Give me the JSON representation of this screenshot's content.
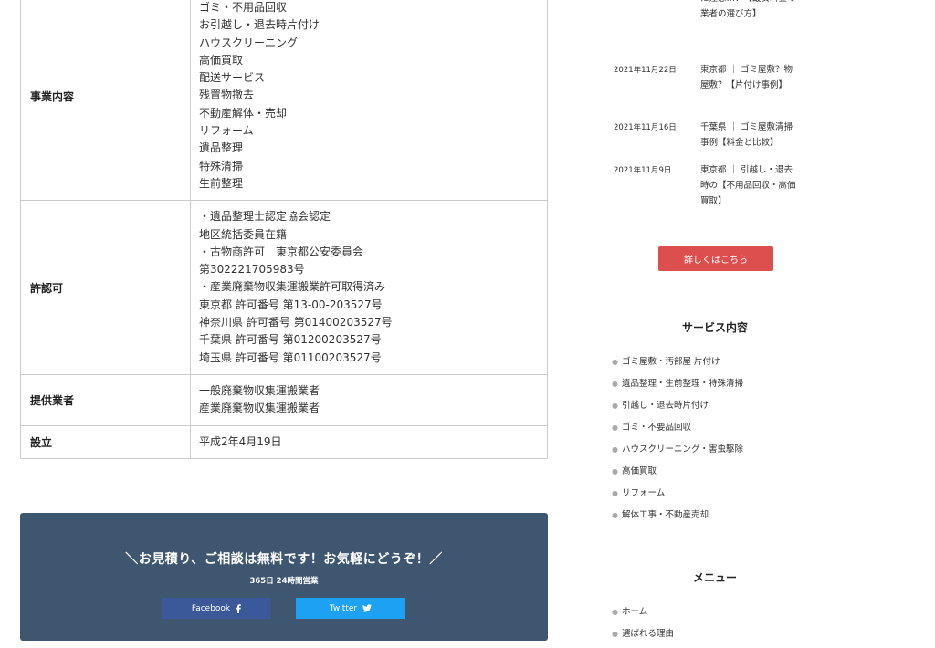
{
  "company_table": {
    "rows": [
      {
        "label": "事業内容",
        "lines": [
          "ゴミ・不用品回収",
          "お引越し・退去時片付け",
          "ハウスクリーニング",
          "高価買取",
          "配送サービス",
          "残置物撤去",
          "不動産解体・売却",
          "リフォーム",
          "遺品整理",
          "特殊清掃",
          "生前整理"
        ]
      },
      {
        "label": "許認可",
        "lines": [
          "・遺品整理士認定協会認定",
          "地区統括委員在籍",
          "・古物商許可　東京都公安委員会",
          "第302221705983号",
          "・産業廃棄物収集運搬業許可取得済み",
          "東京都 許可番号 第13-00-203527号",
          "神奈川県 許可番号 第01400203527号",
          "千葉県 許可番号 第01200203527号",
          "埼玉県 許可番号 第01100203527号"
        ]
      },
      {
        "label": "提供業者",
        "lines": [
          "一般廃棄物収集運搬業者",
          "産業廃棄物収集運搬業者"
        ]
      },
      {
        "label": "設立",
        "lines": [
          "平成2年4月19日"
        ]
      }
    ]
  },
  "cta": {
    "title": "＼お見積り、ご相談は無料です！お気軽にどうぞ！／",
    "subtitle": "365日 24時間営業",
    "facebook_label": "Facebook",
    "twitter_label": "Twitter"
  },
  "news": {
    "items": [
      {
        "date": "",
        "title": "トラブル多発。悪徳業者に注意…！【最安料金で業者の選び方】"
      },
      {
        "date": "2021年11月22日",
        "title": "東京都 ｜ ゴミ屋敷？物屋敷？【片付け事例】"
      },
      {
        "date": "2021年11月16日",
        "title": "千葉県 ｜ ゴミ屋敷清掃事例【料金と比較】"
      },
      {
        "date": "2021年11月9日",
        "title": "東京都 ｜ 引越し・退去時の【不用品回収・高価買取】"
      }
    ],
    "more_button": "詳しくはこちら"
  },
  "services": {
    "heading": "サービス内容",
    "items": [
      "ゴミ屋敷・汚部屋 片付け",
      "遺品整理・生前整理・特殊清掃",
      "引越し・退去時片付け",
      "ゴミ・不要品回収",
      "ハウスクリーニング・害虫駆除",
      "高価買取",
      "リフォーム",
      "解体工事・不動産売却"
    ]
  },
  "menu": {
    "heading": "メニュー",
    "items": [
      "ホーム",
      "選ばれる理由"
    ]
  },
  "colors": {
    "cta_background": "#3e5670",
    "facebook": "#3b5998",
    "twitter": "#1da1f2",
    "more_button": "#dd4f4f"
  }
}
